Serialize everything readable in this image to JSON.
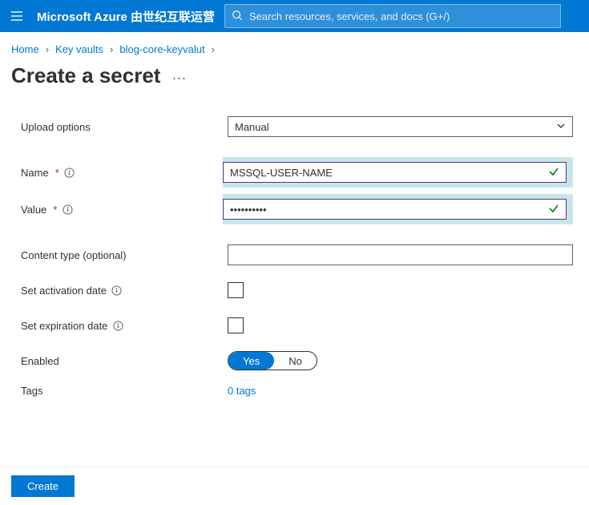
{
  "header": {
    "brand": "Microsoft Azure 由世纪互联运营",
    "search_placeholder": "Search resources, services, and docs (G+/)"
  },
  "breadcrumb": {
    "items": [
      "Home",
      "Key vaults",
      "blog-core-keyvalut"
    ]
  },
  "page": {
    "title": "Create a secret"
  },
  "form": {
    "upload_options": {
      "label": "Upload options",
      "value": "Manual"
    },
    "name_field": {
      "label": "Name",
      "value": "MSSQL-USER-NAME"
    },
    "value_field": {
      "label": "Value",
      "value": "••••••••••"
    },
    "content_type": {
      "label": "Content type (optional)",
      "value": ""
    },
    "activation": {
      "label": "Set activation date"
    },
    "expiration": {
      "label": "Set expiration date"
    },
    "enabled": {
      "label": "Enabled",
      "yes": "Yes",
      "no": "No"
    },
    "tags": {
      "label": "Tags",
      "link": "0 tags"
    }
  },
  "footer": {
    "create": "Create"
  }
}
